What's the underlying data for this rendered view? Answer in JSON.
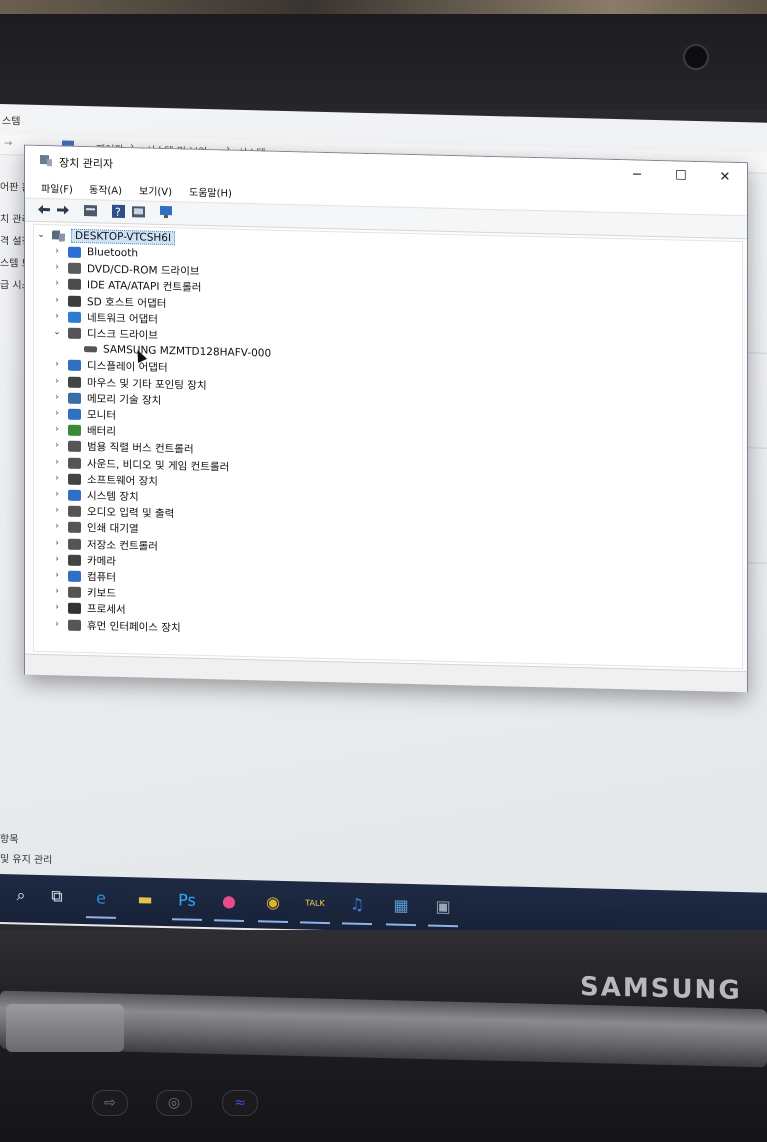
{
  "background_window": {
    "title_fragment": "스템",
    "breadcrumb": [
      "제어판",
      "시스템 및 보안",
      "시스템"
    ],
    "side_items": [
      "어판 홈",
      "치 관리",
      "격 설정",
      "스템 보",
      "급 시스"
    ],
    "bottom_items": [
      "항목",
      "및 유지 관리"
    ]
  },
  "device_manager": {
    "title": "장치 관리자",
    "menu": [
      "파일(F)",
      "동작(A)",
      "보기(V)",
      "도움말(H)"
    ],
    "window_controls": {
      "minimize": "─",
      "maximize": "☐",
      "close": "✕"
    },
    "root": "DESKTOP-VTCSH6I",
    "items": [
      {
        "label": "Bluetooth",
        "icon": "bluetooth-icon",
        "expanded": false,
        "color": "#2b6fd6"
      },
      {
        "label": "DVD/CD-ROM 드라이브",
        "icon": "dvd-drive-icon",
        "expanded": false,
        "color": "#5a5a5a"
      },
      {
        "label": "IDE ATA/ATAPI 컨트롤러",
        "icon": "ide-controller-icon",
        "expanded": false,
        "color": "#4b4b4b"
      },
      {
        "label": "SD 호스트 어댑터",
        "icon": "sd-host-icon",
        "expanded": false,
        "color": "#3d3d3d"
      },
      {
        "label": "네트워크 어댑터",
        "icon": "network-adapter-icon",
        "expanded": false,
        "color": "#2e7bd1"
      },
      {
        "label": "디스크 드라이브",
        "icon": "disk-drive-icon",
        "expanded": true,
        "color": "#555",
        "children": [
          {
            "label": "SAMSUNG MZMTD128HAFV-000",
            "icon": "disk-icon",
            "color": "#555"
          }
        ]
      },
      {
        "label": "디스플레이 어댑터",
        "icon": "display-adapter-icon",
        "expanded": false,
        "color": "#2f6fc4"
      },
      {
        "label": "마우스 및 기타 포인팅 장치",
        "icon": "mouse-icon",
        "expanded": false,
        "color": "#444"
      },
      {
        "label": "메모리 기술 장치",
        "icon": "memory-device-icon",
        "expanded": false,
        "color": "#3a6ea8"
      },
      {
        "label": "모니터",
        "icon": "monitor-icon",
        "expanded": false,
        "color": "#2f6fc4"
      },
      {
        "label": "배터리",
        "icon": "battery-icon",
        "expanded": false,
        "color": "#3a8a3a"
      },
      {
        "label": "범용 직렬 버스 컨트롤러",
        "icon": "usb-icon",
        "expanded": false,
        "color": "#555"
      },
      {
        "label": "사운드, 비디오 및 게임 컨트롤러",
        "icon": "sound-icon",
        "expanded": false,
        "color": "#555"
      },
      {
        "label": "소프트웨어 장치",
        "icon": "software-device-icon",
        "expanded": false,
        "color": "#444"
      },
      {
        "label": "시스템 장치",
        "icon": "system-device-icon",
        "expanded": false,
        "color": "#2f6fc4"
      },
      {
        "label": "오디오 입력 및 출력",
        "icon": "audio-io-icon",
        "expanded": false,
        "color": "#555"
      },
      {
        "label": "인쇄 대기열",
        "icon": "printer-icon",
        "expanded": false,
        "color": "#555"
      },
      {
        "label": "저장소 컨트롤러",
        "icon": "storage-controller-icon",
        "expanded": false,
        "color": "#555"
      },
      {
        "label": "카메라",
        "icon": "camera-icon",
        "expanded": false,
        "color": "#444"
      },
      {
        "label": "컴퓨터",
        "icon": "computer-icon",
        "expanded": false,
        "color": "#2f6fc4"
      },
      {
        "label": "키보드",
        "icon": "keyboard-icon",
        "expanded": false,
        "color": "#555"
      },
      {
        "label": "프로세서",
        "icon": "processor-icon",
        "expanded": false,
        "color": "#333"
      },
      {
        "label": "휴먼 인터페이스 장치",
        "icon": "hid-icon",
        "expanded": false,
        "color": "#555"
      }
    ]
  },
  "taskbar": {
    "apps": [
      {
        "name": "search-icon",
        "glyph": "⌕",
        "active": false
      },
      {
        "name": "task-view-icon",
        "glyph": "⧉",
        "active": false
      },
      {
        "name": "edge-icon",
        "glyph": "e",
        "active": true,
        "color": "#2b8fe0"
      },
      {
        "name": "file-explorer-icon",
        "glyph": "▬",
        "active": false,
        "color": "#e8c04a"
      },
      {
        "name": "photoshop-icon",
        "glyph": "Ps",
        "active": true,
        "color": "#31a8ff"
      },
      {
        "name": "paint-3d-icon",
        "glyph": "●",
        "active": true,
        "color": "#e74c8a"
      },
      {
        "name": "chrome-icon",
        "glyph": "◉",
        "active": true,
        "color": "#e0b030"
      },
      {
        "name": "kakaotalk-icon",
        "glyph": "TALK",
        "active": true,
        "color": "#f3d34a"
      },
      {
        "name": "music-app-icon",
        "glyph": "♫",
        "active": true,
        "color": "#3f7be0"
      },
      {
        "name": "control-panel-icon",
        "glyph": "▦",
        "active": true,
        "color": "#5aa0d8"
      },
      {
        "name": "device-manager-icon",
        "glyph": "▣",
        "active": true,
        "color": "#9aa5b5"
      }
    ]
  },
  "laptop": {
    "brand": "SAMSUNG"
  }
}
